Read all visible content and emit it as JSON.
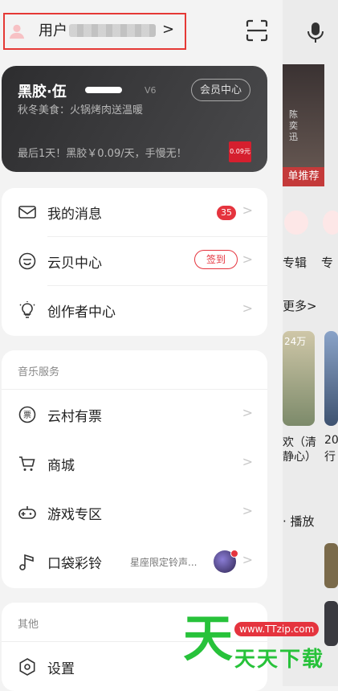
{
  "header": {
    "username_prefix": "用户"
  },
  "vip": {
    "title": "黑胶·伍",
    "level": "V6",
    "center_button": "会员中心",
    "subtitle": "秋冬美食：火锅烤肉送温暖",
    "offer": "最后1天！黑胶￥0.09/天，手慢无！",
    "price_tag": "0.09元"
  },
  "menu_main": [
    {
      "label": "我的消息",
      "badge": "35"
    },
    {
      "label": "云贝中心",
      "action": "签到"
    },
    {
      "label": "创作者中心"
    }
  ],
  "music_services": {
    "title": "音乐服务",
    "items": [
      {
        "label": "云村有票"
      },
      {
        "label": "商城"
      },
      {
        "label": "游戏专区"
      },
      {
        "label": "口袋彩铃",
        "hint": "星座限定铃声..."
      }
    ]
  },
  "other": {
    "title": "其他",
    "items": [
      {
        "label": "设置"
      }
    ]
  },
  "background": {
    "card_tag": "单推荐",
    "card_text": "陈奕迅",
    "label_1": "专辑",
    "label_2": "专",
    "more": "更多>",
    "count": "24万",
    "song_1": "欢（清",
    "song_1b": "静心）",
    "year": "20",
    "year_b": "行",
    "play": "· 播放"
  },
  "watermark": {
    "site": "www.TTzip.com",
    "text": "天天下载"
  },
  "colors": {
    "accent": "#e5343e",
    "vip_bg": "#2d2d2f"
  }
}
